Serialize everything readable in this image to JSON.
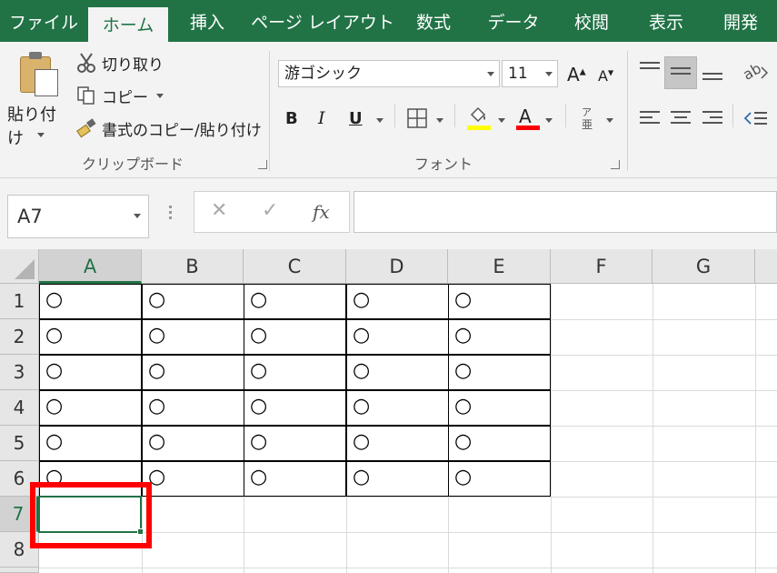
{
  "tabs": [
    {
      "label": "ファイル",
      "active": false
    },
    {
      "label": "ホーム",
      "active": true
    },
    {
      "label": "挿入",
      "active": false
    },
    {
      "label": "ページ レイアウト",
      "active": false
    },
    {
      "label": "数式",
      "active": false
    },
    {
      "label": "データ",
      "active": false
    },
    {
      "label": "校閲",
      "active": false
    },
    {
      "label": "表示",
      "active": false
    },
    {
      "label": "開発",
      "active": false
    }
  ],
  "clipboard": {
    "paste_label": "貼り付け",
    "cut_label": "切り取り",
    "copy_label": "コピー",
    "format_painter_label": "書式のコピー/貼り付け",
    "group_label": "クリップボード"
  },
  "font": {
    "font_name": "游ゴシック",
    "font_size": "11",
    "bold": "B",
    "italic": "I",
    "underline": "U",
    "font_color_letter": "A",
    "group_label": "フォント"
  },
  "formula_bar": {
    "name_box": "A7",
    "cancel_symbol": "✕",
    "enter_symbol": "✓",
    "fx_symbol": "fx",
    "formula": ""
  },
  "sheet": {
    "columns": [
      "A",
      "B",
      "C",
      "D",
      "E",
      "F",
      "G"
    ],
    "rows": [
      "1",
      "2",
      "3",
      "4",
      "5",
      "6",
      "7",
      "8"
    ],
    "selected_cell": "A7",
    "cells": [
      [
        "○",
        "○",
        "○",
        "○",
        "○"
      ],
      [
        "○",
        "○",
        "○",
        "○",
        "○"
      ],
      [
        "○",
        "○",
        "○",
        "○",
        "○"
      ],
      [
        "○",
        "○",
        "○",
        "○",
        "○"
      ],
      [
        "○",
        "○",
        "○",
        "○",
        "○"
      ],
      [
        "○",
        "○",
        "○",
        "○",
        "○"
      ]
    ]
  },
  "colors": {
    "excel_green": "#217346",
    "highlight_red": "#ff0000",
    "fill_yellow": "#ffff00",
    "font_red": "#ff0000"
  }
}
